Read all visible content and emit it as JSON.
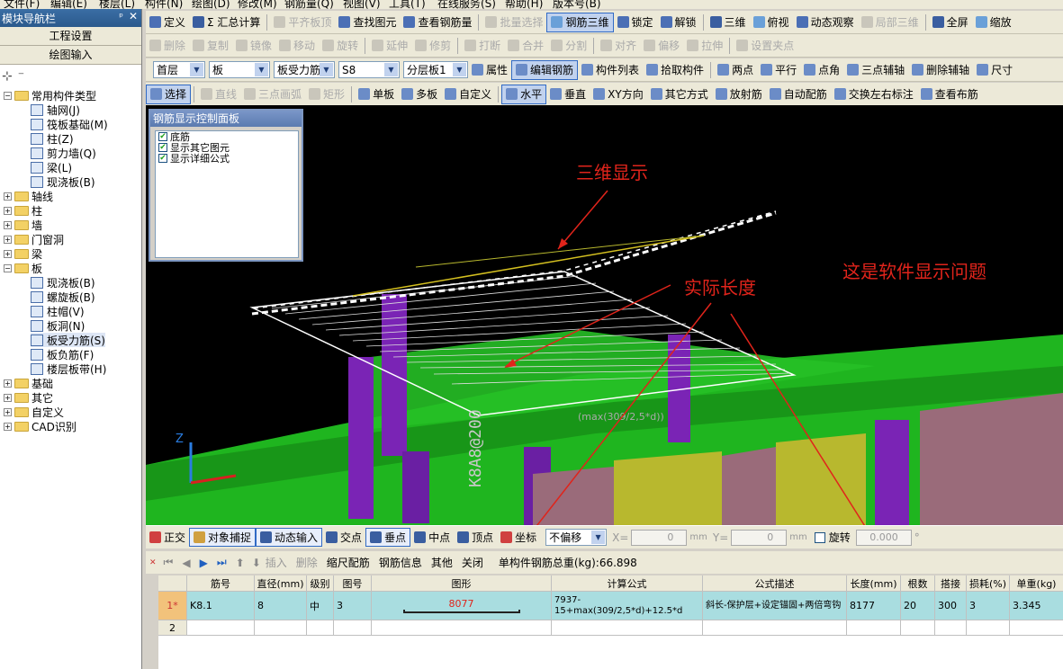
{
  "menu": {
    "items": [
      "文件(F)",
      "编辑(E)",
      "楼层(L)",
      "构件(N)",
      "绘图(D)",
      "修改(M)",
      "钢筋量(Q)",
      "视图(V)",
      "工具(T)",
      "在线服务(S)",
      "帮助(H)",
      "版本号(B)"
    ]
  },
  "toolbar1": {
    "items": [
      "定义",
      "Σ 汇总计算",
      "平齐板顶",
      "查找图元",
      "查看钢筋量",
      "批量选择",
      "钢筋三维",
      "锁定",
      "解锁",
      "三维",
      "俯视",
      "动态观察",
      "局部三维",
      "全屏",
      "缩放"
    ]
  },
  "toolbar2": {
    "items": [
      "删除",
      "复制",
      "镜像",
      "移动",
      "旋转",
      "延伸",
      "修剪",
      "打断",
      "合并",
      "分割",
      "对齐",
      "偏移",
      "拉伸",
      "设置夹点"
    ]
  },
  "toolbar3": {
    "floor": "首层",
    "type": "板",
    "subtype": "板受力筋",
    "name": "S8",
    "layer": "分层板1",
    "items": [
      "属性",
      "编辑钢筋",
      "构件列表",
      "拾取构件",
      "两点",
      "平行",
      "点角",
      "三点辅轴",
      "删除辅轴",
      "尺寸"
    ]
  },
  "toolbar4": {
    "items": [
      "选择",
      "直线",
      "三点画弧",
      "矩形",
      "单板",
      "多板",
      "自定义",
      "水平",
      "垂直",
      "XY方向",
      "其它方式",
      "放射筋",
      "自动配筋",
      "交换左右标注",
      "查看布筋"
    ]
  },
  "left_panel": {
    "title": "模块导航栏",
    "btn1": "工程设置",
    "btn2": "绘图输入",
    "tree": [
      {
        "label": "常用构件类型",
        "level": 0,
        "type": "folder",
        "expanded": true
      },
      {
        "label": "轴网(J)",
        "level": 1
      },
      {
        "label": "筏板基础(M)",
        "level": 1
      },
      {
        "label": "柱(Z)",
        "level": 1
      },
      {
        "label": "剪力墙(Q)",
        "level": 1
      },
      {
        "label": "梁(L)",
        "level": 1
      },
      {
        "label": "现浇板(B)",
        "level": 1
      },
      {
        "label": "轴线",
        "level": 0,
        "type": "folder"
      },
      {
        "label": "柱",
        "level": 0,
        "type": "folder"
      },
      {
        "label": "墙",
        "level": 0,
        "type": "folder"
      },
      {
        "label": "门窗洞",
        "level": 0,
        "type": "folder"
      },
      {
        "label": "梁",
        "level": 0,
        "type": "folder"
      },
      {
        "label": "板",
        "level": 0,
        "type": "folder",
        "expanded": true
      },
      {
        "label": "现浇板(B)",
        "level": 1
      },
      {
        "label": "螺旋板(B)",
        "level": 1
      },
      {
        "label": "柱帽(V)",
        "level": 1
      },
      {
        "label": "板洞(N)",
        "level": 1
      },
      {
        "label": "板受力筋(S)",
        "level": 1
      },
      {
        "label": "板负筋(F)",
        "level": 1
      },
      {
        "label": "楼层板带(H)",
        "level": 1
      },
      {
        "label": "基础",
        "level": 0,
        "type": "folder"
      },
      {
        "label": "其它",
        "level": 0,
        "type": "folder"
      },
      {
        "label": "自定义",
        "level": 0,
        "type": "folder"
      },
      {
        "label": "CAD识别",
        "level": 0,
        "type": "folder"
      }
    ]
  },
  "rebar_panel": {
    "title": "钢筋显示控制面板",
    "checks": [
      "底筋",
      "显示其它图元",
      "显示详细公式"
    ]
  },
  "viewport": {
    "ann1": "三维显示",
    "ann2": "实际长度",
    "ann3": "这是软件显示问题",
    "label_vert": "K8A8@200",
    "label_formula": "(max(309/2,5*d))",
    "label_8077": "8077",
    "axis_z": "Z",
    "colors": {
      "green": "#1fb51f",
      "purple": "#7a24b5",
      "yellow": "#b8b82e",
      "red": "#e0241b"
    }
  },
  "snap_bar": {
    "items": [
      "正交",
      "对象捕捉",
      "动态输入",
      "交点",
      "垂点",
      "中点",
      "顶点",
      "坐标"
    ],
    "offset": "不偏移",
    "x_label": "X=",
    "x_val": "0",
    "y_label": "Y=",
    "y_val": "0",
    "unit": "mm",
    "rotate": "旋转",
    "rotate_val": "0.000",
    "deg": "°"
  },
  "grid_toolbar": {
    "items": [
      "插入",
      "删除",
      "缩尺配筋",
      "钢筋信息",
      "其他",
      "关闭"
    ],
    "total": "单构件钢筋总重(kg):66.898"
  },
  "table": {
    "headers": [
      "筋号",
      "直径(mm)",
      "级别",
      "图号",
      "图形",
      "计算公式",
      "公式描述",
      "长度(mm)",
      "根数",
      "搭接",
      "损耗(%)",
      "单重(kg)"
    ],
    "rows": [
      {
        "rn": "1*",
        "cells": [
          "K8.1",
          "8",
          "中",
          "3",
          "8077",
          "7937-15+max(309/2,5*d)+12.5*d",
          "斜长-保护层+设定锚固+两倍弯钩",
          "8177",
          "20",
          "300",
          "3",
          "3.345"
        ]
      },
      {
        "rn": "2",
        "cells": [
          "",
          "",
          "",
          "",
          "",
          "",
          "",
          "",
          "",
          "",
          "",
          ""
        ]
      }
    ]
  }
}
